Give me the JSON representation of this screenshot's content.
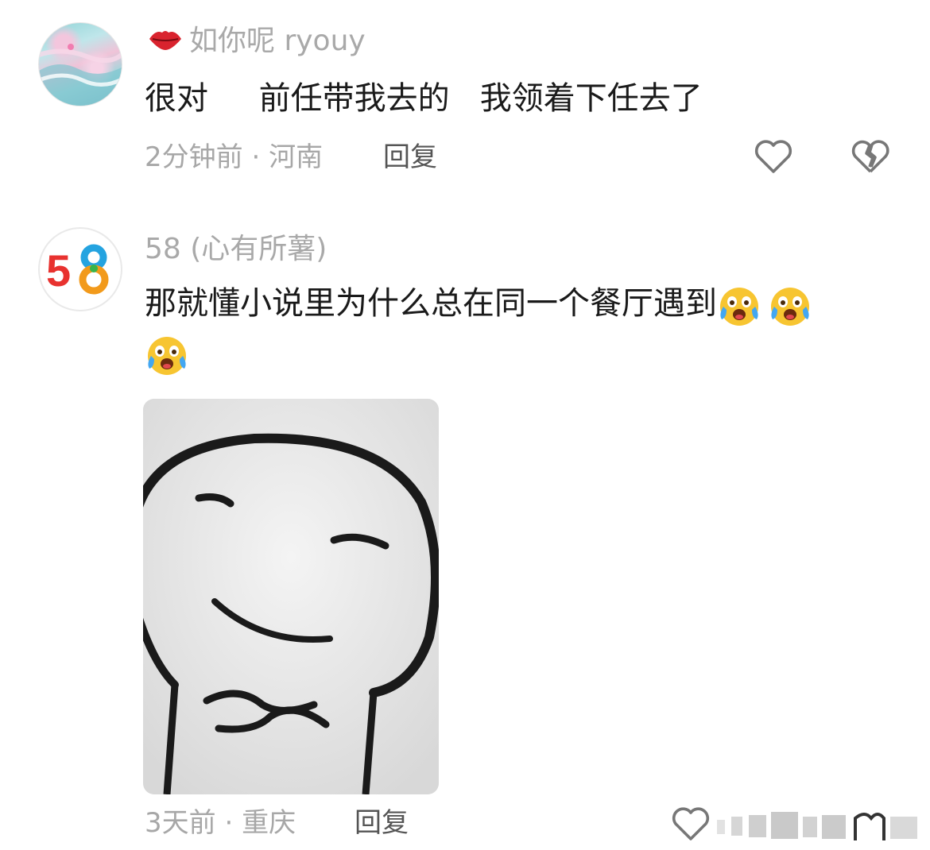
{
  "comments": [
    {
      "username": "如你呢 ryouy",
      "username_icon": "lips-icon",
      "text": "很对     前任带我去的   我领着下任去了",
      "time": "2分钟前",
      "location": "河南",
      "meta_separator": "·",
      "reply_label": "回复",
      "avatar_icon": "sea-photo-avatar"
    },
    {
      "username": "58 (心有所薯)",
      "text": "那就懂小说里为什么总在同一个餐厅遇到",
      "emoji_name": "crying-laughing-face-icon",
      "emoji_count": 3,
      "time": "3天前",
      "location": "重庆",
      "meta_separator": "·",
      "reply_label": "回复",
      "avatar_text": "58",
      "avatar_colors": {
        "five": "#e8322f",
        "eight_top": "#24a3e0",
        "eight_bottom": "#f29a1b",
        "eight_mid": "#37b44a"
      },
      "image": "smirking-meme-sticker"
    }
  ],
  "icons": {
    "like": "heart-outline-icon",
    "dislike": "broken-heart-icon"
  },
  "colors": {
    "meta": "#a7a7a7",
    "text": "#1a1a1a",
    "reply": "#555555"
  }
}
